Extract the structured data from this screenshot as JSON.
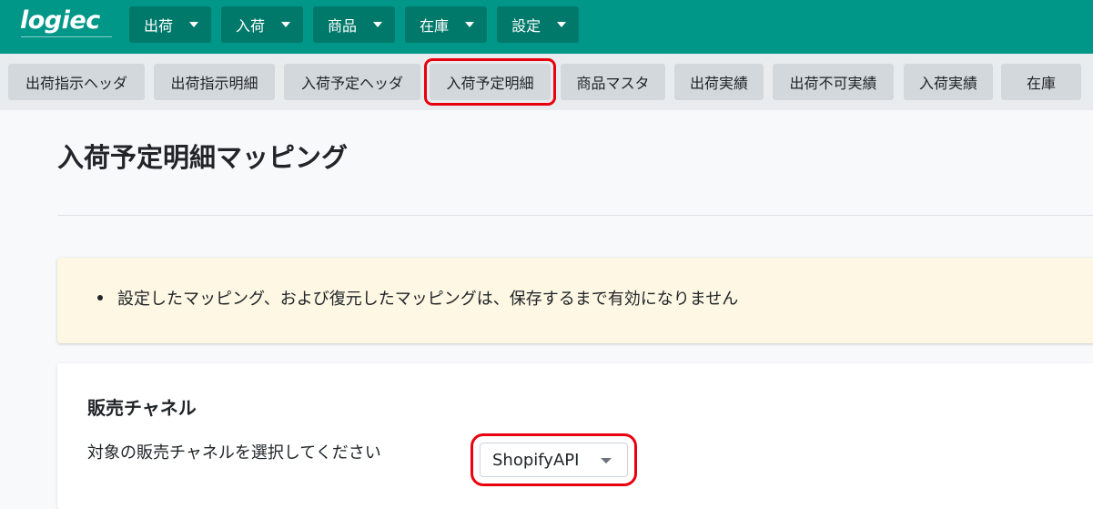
{
  "brand": {
    "logo_text": "logiec"
  },
  "topnav": {
    "items": [
      {
        "label": "出荷"
      },
      {
        "label": "入荷"
      },
      {
        "label": "商品"
      },
      {
        "label": "在庫"
      },
      {
        "label": "設定"
      }
    ]
  },
  "tabs": {
    "items": [
      {
        "label": "出荷指示ヘッダ"
      },
      {
        "label": "出荷指示明細"
      },
      {
        "label": "入荷予定ヘッダ"
      },
      {
        "label": "入荷予定明細",
        "selected": true
      },
      {
        "label": "商品マスタ"
      },
      {
        "label": "出荷実績"
      },
      {
        "label": "出荷不可実績"
      },
      {
        "label": "入荷実績"
      },
      {
        "label": "在庫"
      }
    ]
  },
  "page": {
    "title": "入荷予定明細マッピング"
  },
  "notice": {
    "items": [
      "設定したマッピング、および復元したマッピングは、保存するまで有効になりません"
    ]
  },
  "sales_channel": {
    "section_title": "販売チャネル",
    "prompt": "対象の販売チャネルを選択してください",
    "selected_value": "ShopifyAPI"
  },
  "colors": {
    "header_green": "#009688",
    "nav_button": "#00796b",
    "highlight_red": "#e8000f",
    "notice_background": "#fdf7e3"
  }
}
